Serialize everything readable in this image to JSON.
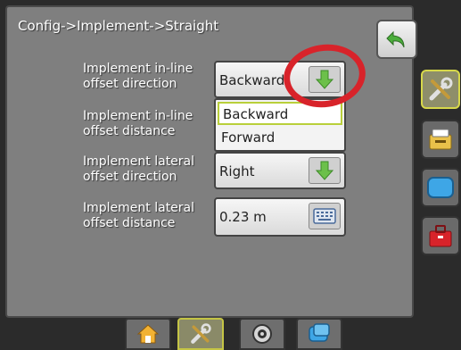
{
  "header": {
    "breadcrumb": "Config->Implement->Straight"
  },
  "settings": [
    {
      "label_line1": "Implement in-line",
      "label_line2": "offset direction",
      "value": "Backward",
      "control": "arrow-down-icon"
    },
    {
      "label_line1": "Implement in-line",
      "label_line2": "offset distance",
      "value": "",
      "control": ""
    },
    {
      "label_line1": "Implement lateral",
      "label_line2": "offset direction",
      "value": "Right",
      "control": "arrow-down-icon"
    },
    {
      "label_line1": "Implement lateral",
      "label_line2": "offset distance",
      "value": "0.23 m",
      "control": "keyboard-icon"
    }
  ],
  "dropdown": {
    "options": [
      "Backward",
      "Forward"
    ],
    "selected": "Backward"
  },
  "sidebar": {
    "items": [
      {
        "icon": "tools-icon",
        "active": true
      },
      {
        "icon": "console-icon",
        "active": false
      },
      {
        "icon": "display-icon",
        "active": false
      },
      {
        "icon": "toolbox-icon",
        "active": false
      }
    ]
  },
  "bottom_tabs": {
    "items": [
      {
        "icon": "home-icon",
        "active": false
      },
      {
        "icon": "tools-icon",
        "active": true
      },
      {
        "icon": "gps-icon",
        "active": false
      },
      {
        "icon": "guidance-icon",
        "active": false
      }
    ]
  },
  "colors": {
    "panel_bg": "#7f7f7f",
    "arrow_green": "#6cc04a",
    "highlight_ring": "#d8232a",
    "selected_border": "#b9cf3a"
  }
}
